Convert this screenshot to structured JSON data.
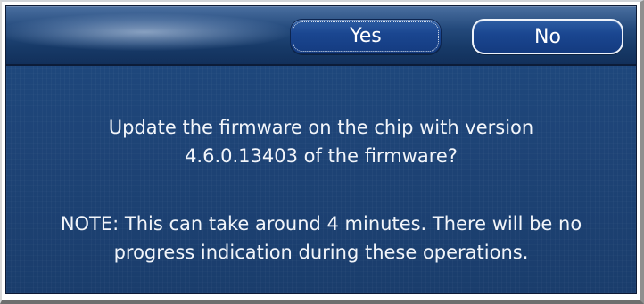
{
  "dialog": {
    "buttons": {
      "yes_label": "Yes",
      "no_label": "No"
    },
    "message": {
      "question_lines": [
        "Update the firmware on the chip with version",
        "4.6.0.13403 of the firmware?"
      ],
      "note_lines": [
        "NOTE: This can take around 4 minutes.  There will be no",
        "progress indication during these operations."
      ]
    }
  },
  "colors": {
    "dialog_background": "#1e4477",
    "titlebar_top": "#4a6fa0",
    "button_fill": "#1a4690",
    "text": "#f2f5fa"
  }
}
